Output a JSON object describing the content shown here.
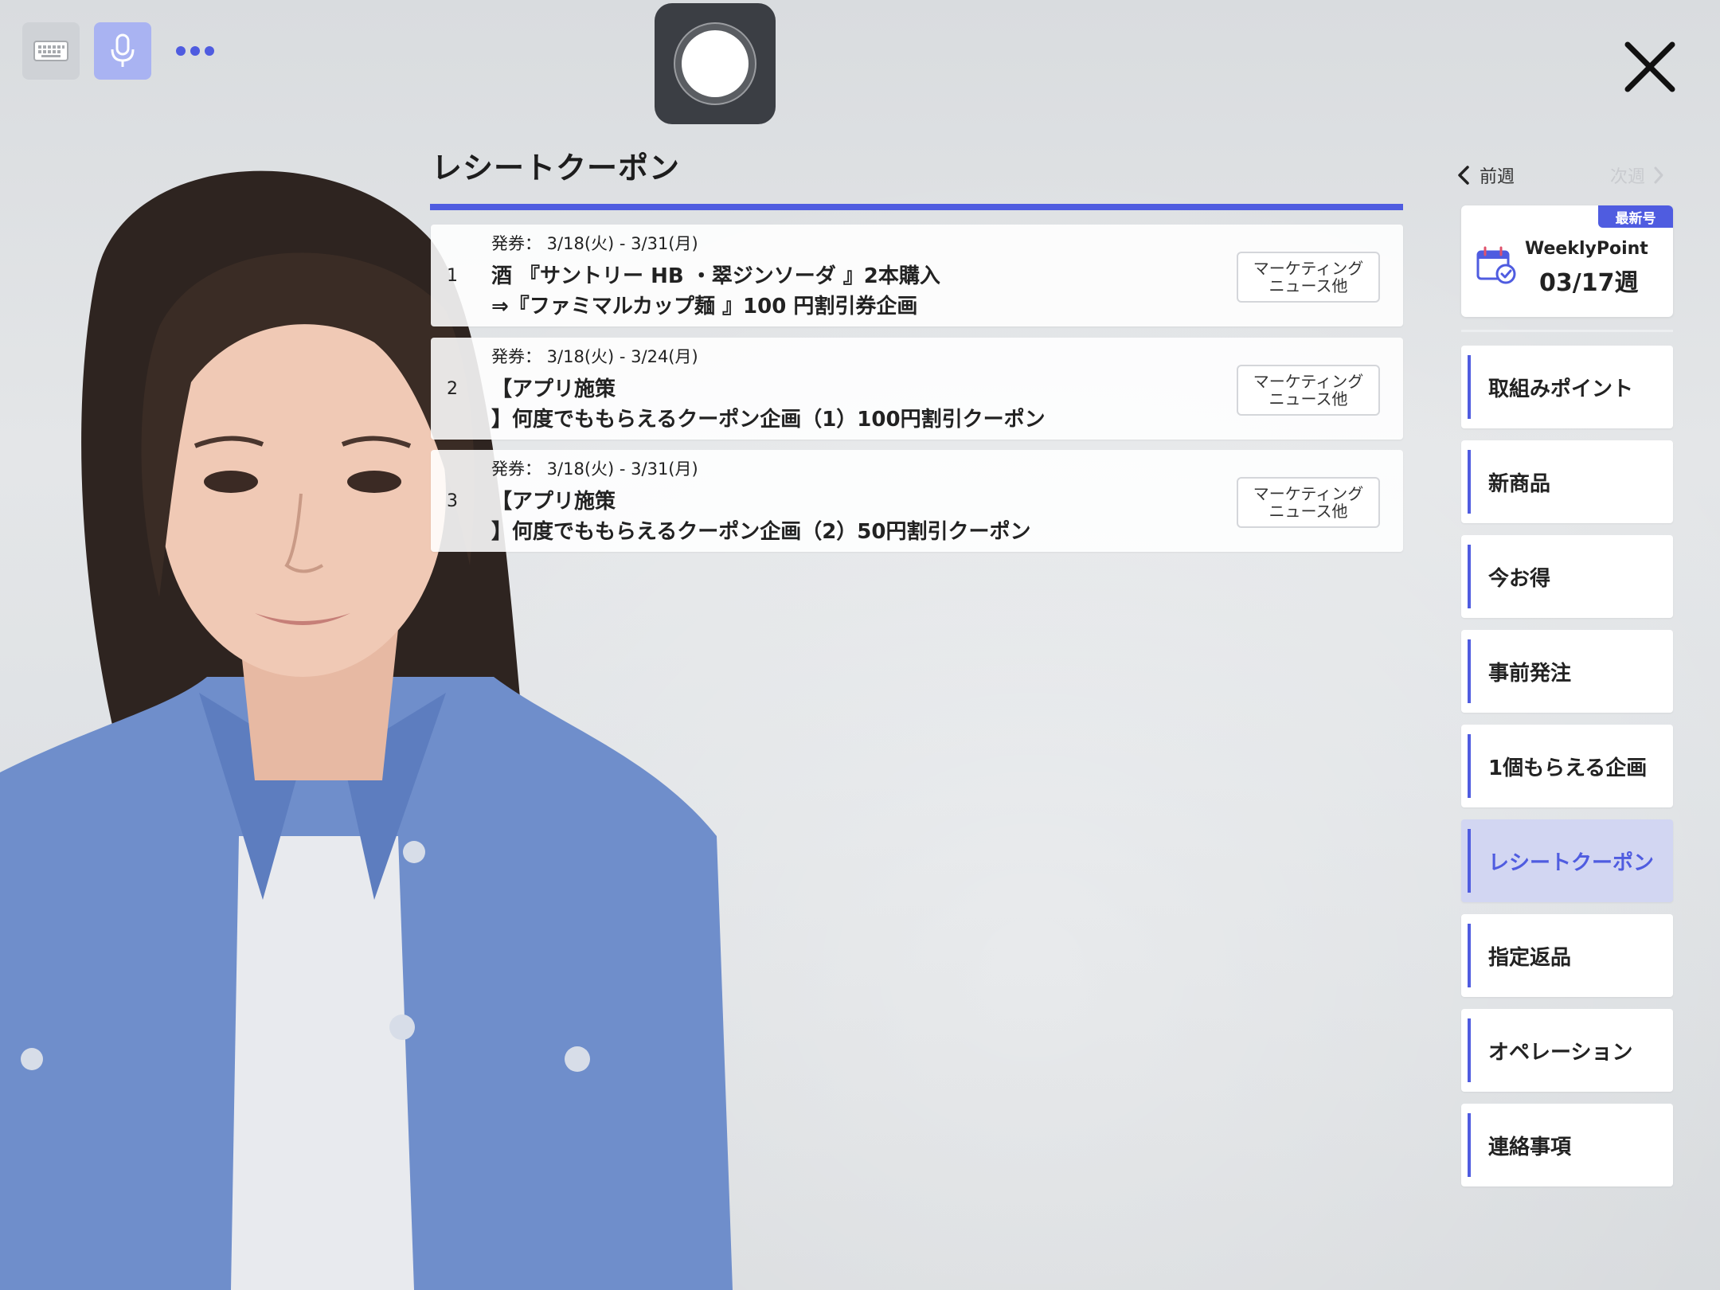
{
  "toolbar": {
    "keyboard_icon": "keyboard-icon",
    "mic_icon": "microphone-icon",
    "more_icon": "more-dots-icon",
    "record_icon": "record-icon",
    "close_icon": "close-icon"
  },
  "panel": {
    "title": "レシートクーポン",
    "coupons": [
      {
        "num": "1",
        "date": "発券： 3/18(火) - 3/31(月)",
        "line1": "酒 『サントリー HB ・翠ジンソーダ 』2本購入",
        "line2": "⇒『ファミマルカップ麺 』100 円割引券企画",
        "tag": "マーケティング\nニュース他"
      },
      {
        "num": "2",
        "date": "発券： 3/18(火) - 3/24(月)",
        "line1": "【アプリ施策",
        "line2": "】何度でももらえるクーポン企画（1）100円割引クーポン",
        "tag": "マーケティング\nニュース他"
      },
      {
        "num": "3",
        "date": "発券： 3/18(火) - 3/31(月)",
        "line1": "【アプリ施策",
        "line2": "】何度でももらえるクーポン企画（2）50円割引クーポン",
        "tag": "マーケティング\nニュース他"
      }
    ]
  },
  "sidebar": {
    "prev_week": "前週",
    "next_week": "次週",
    "card": {
      "badge": "最新号",
      "brand": "WeeklyPoint",
      "week": "03/17週",
      "icon": "calendar-check-icon"
    },
    "items": [
      {
        "label": "取組みポイント",
        "active": false
      },
      {
        "label": "新商品",
        "active": false
      },
      {
        "label": "今お得",
        "active": false
      },
      {
        "label": "事前発注",
        "active": false
      },
      {
        "label": "1個もらえる企画",
        "active": false
      },
      {
        "label": "レシートクーポン",
        "active": true
      },
      {
        "label": "指定返品",
        "active": false
      },
      {
        "label": "オペレーション",
        "active": false
      },
      {
        "label": "連絡事項",
        "active": false
      }
    ]
  },
  "colors": {
    "accent": "#4f5ce0",
    "active_bg": "#d2d6f2",
    "mic_bg": "#a9b3f2",
    "record_bg": "#3b3e44"
  }
}
